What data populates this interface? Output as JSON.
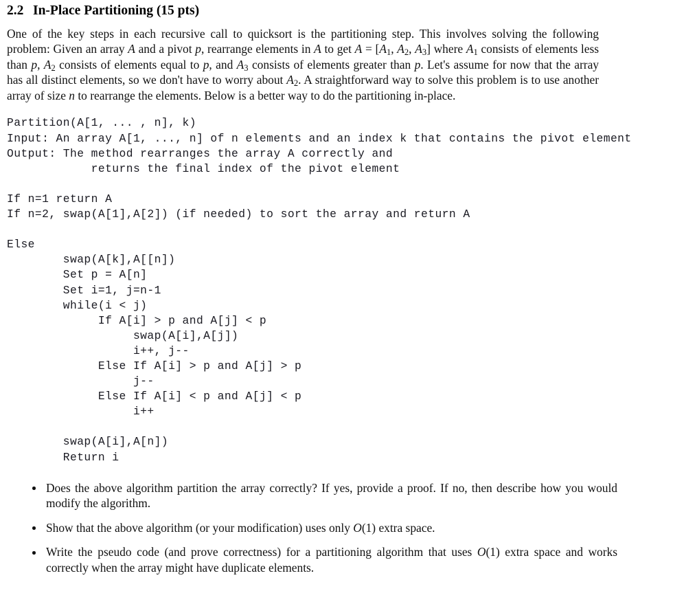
{
  "document": {
    "heading": {
      "number": "2.2",
      "title": "In-Place Partitioning (15 pts)"
    },
    "paragraph": {
      "t1": "One of the key steps in each recursive call to quicksort is the partitioning step. This involves solving the following problem: Given an array ",
      "v_A1": "A",
      "t2": " and a pivot ",
      "v_p1": "p",
      "t3": ", rearrange elements in ",
      "v_A2": "A",
      "t4": " to get ",
      "v_A3": "A",
      "t5": " = ",
      "v_bracket_open": "[",
      "v_A_1": "A",
      "v_sub1": "1",
      "t6": ", ",
      "v_A_2": "A",
      "v_sub2": "2",
      "t7": ", ",
      "v_A_3": "A",
      "v_sub3": "3",
      "v_bracket_close": "]",
      "t8": " where ",
      "v_A_1b": "A",
      "v_sub1b": "1",
      "t9": " consists of elements less than ",
      "v_p2": "p",
      "t10": ", ",
      "v_A_2b": "A",
      "v_sub2b": "2",
      "t11": " consists of elements equal to ",
      "v_p3": "p",
      "t12": ", and ",
      "v_A_3b": "A",
      "v_sub3b": "3",
      "t13": " consists of elements greater than ",
      "v_p4": "p",
      "t14": ". Let's assume for now that the array has all distinct elements, so we don't have to worry about ",
      "v_A_2c": "A",
      "v_sub2c": "2",
      "t15": ". A straightforward way to solve this problem is to use another array of size ",
      "v_n": "n",
      "t16": " to rearrange the elements. Below is a better way to do the partitioning in-place."
    },
    "pseudocode": {
      "lines": [
        "Partition(A[1, ... , n], k)",
        "Input: An array A[1, ..., n] of n elements and an index k that contains the pivot element",
        "Output: The method rearranges the array A correctly and",
        "            returns the final index of the pivot element",
        "",
        "If n=1 return A",
        "If n=2, swap(A[1],A[2]) (if needed) to sort the array and return A",
        "",
        "Else",
        "        swap(A[k],A[[n])",
        "        Set p = A[n]",
        "        Set i=1, j=n-1",
        "        while(i < j)",
        "             If A[i] > p and A[j] < p",
        "                  swap(A[i],A[j])",
        "                  i++, j--",
        "             Else If A[i] > p and A[j] > p",
        "                  j--",
        "             Else If A[i] < p and A[j] < p",
        "                  i++",
        "",
        "        swap(A[i],A[n])",
        "        Return i"
      ]
    },
    "questions": {
      "q1": {
        "text": "Does the above algorithm partition the array correctly? If yes, provide a proof. If no, then describe how you would modify the algorithm."
      },
      "q2": {
        "lead": "Show that the above algorithm (or your modification) uses only ",
        "bigO_symbol": "O",
        "bigO_arg": "(1)",
        "tail": " extra space."
      },
      "q3": {
        "lead": "Write the pseudo code (and prove correctness) for a partitioning algorithm that uses ",
        "bigO_symbol": "O",
        "bigO_arg": "(1)",
        "tail": " extra space and works correctly when the array might have duplicate elements."
      }
    }
  }
}
